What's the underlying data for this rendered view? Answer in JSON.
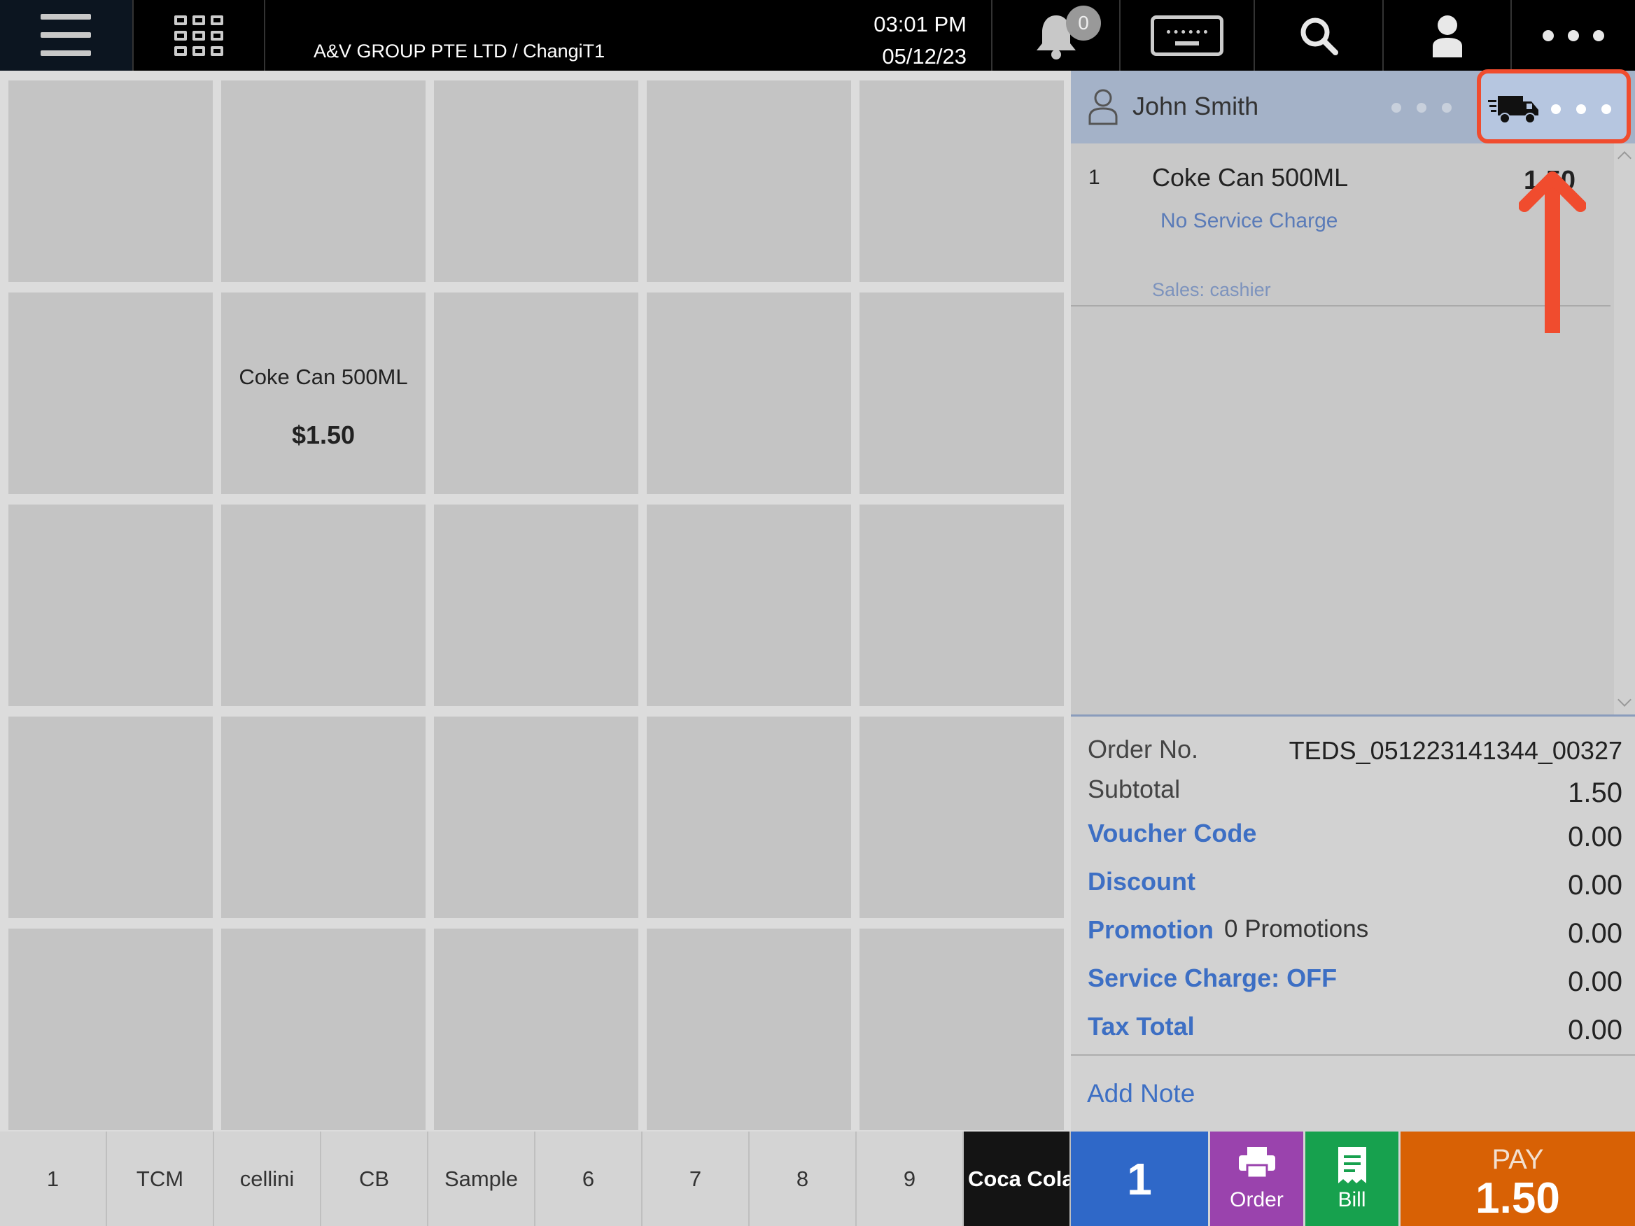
{
  "header": {
    "store": "A&V GROUP PTE LTD / ChangiT1",
    "time": "03:01 PM",
    "date": "05/12/23",
    "notification_count": "0"
  },
  "products": [
    {
      "name": "Coke Can 500ML",
      "price": "$1.50"
    }
  ],
  "categories": [
    "1",
    "TCM",
    "cellini",
    "CB",
    "Sample",
    "6",
    "7",
    "8",
    "9",
    "Coca Cola"
  ],
  "active_category": "Coca Cola",
  "customer": {
    "name": "John Smith"
  },
  "order_lines": [
    {
      "qty": "1",
      "name": "Coke Can 500ML",
      "price": "1.50",
      "modifier": "No Service Charge",
      "sales": "Sales: cashier"
    }
  ],
  "totals": {
    "order_no_label": "Order No.",
    "order_no": "TEDS_051223141344_00327",
    "subtotal_label": "Subtotal",
    "subtotal": "1.50",
    "voucher_label": "Voucher Code",
    "voucher": "0.00",
    "discount_label": "Discount",
    "discount": "0.00",
    "promotion_label": "Promotion",
    "promotion_count": "0 Promotions",
    "promotion": "0.00",
    "service_label": "Service Charge: OFF",
    "service": "0.00",
    "tax_label": "Tax Total",
    "tax": "0.00",
    "add_note": "Add Note"
  },
  "actions": {
    "qty": "1",
    "order": "Order",
    "bill": "Bill",
    "pay_label": "PAY",
    "pay_amount": "1.50"
  },
  "colors": {
    "highlight": "#f04c2e",
    "link": "#3d6fc4",
    "qty_button": "#2f68c8",
    "order_button": "#9a43ad",
    "bill_button": "#17a14e",
    "pay_button": "#d86105"
  }
}
